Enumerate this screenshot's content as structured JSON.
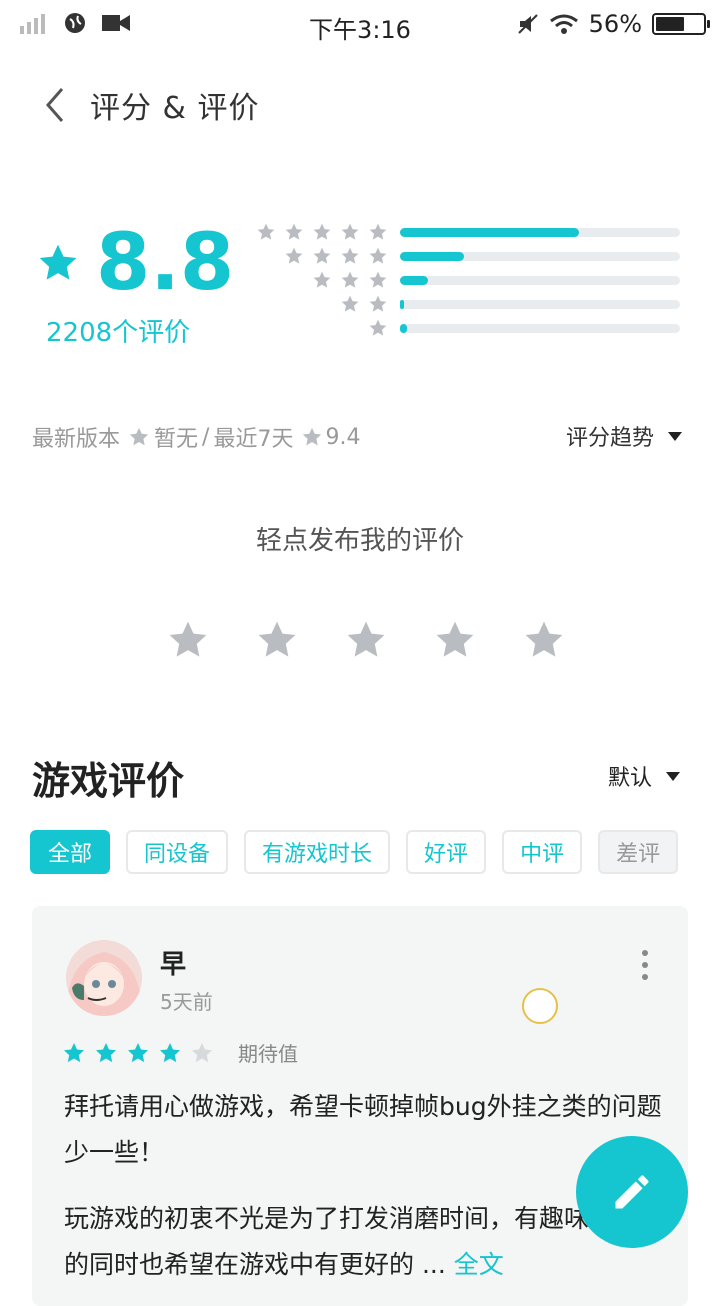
{
  "status_bar": {
    "time": "下午3:16",
    "battery_text": "56%"
  },
  "header": {
    "title": "评分 & 评价"
  },
  "summary": {
    "score": "8.8",
    "rating_count": "2208个评价",
    "distribution": [
      {
        "stars": 5,
        "fraction": 0.64
      },
      {
        "stars": 4,
        "fraction": 0.23
      },
      {
        "stars": 3,
        "fraction": 0.1
      },
      {
        "stars": 2,
        "fraction": 0.015
      },
      {
        "stars": 1,
        "fraction": 0.025
      }
    ]
  },
  "version": {
    "label": "最新版本",
    "current": "暂无",
    "separator": "/",
    "recent_label": "最近7天",
    "recent_score": "9.4",
    "trend_label": "评分趋势"
  },
  "rate": {
    "prompt": "轻点发布我的评价"
  },
  "reviews": {
    "section_title": "游戏评价",
    "sort_label": "默认",
    "filters": [
      "全部",
      "同设备",
      "有游戏时长",
      "好评",
      "中评",
      "差评"
    ],
    "items": [
      {
        "user": "早",
        "time": "5天前",
        "stars": 4,
        "tag": "期待值",
        "paragraph1": "拜托请用心做游戏，希望卡顿掉帧bug外挂之类的问题少一些！",
        "paragraph2": "玩游戏的初衷不光是为了打发消磨时间，有趣味性的同时也希望在游戏中有更好的 ...",
        "full_text": "全文"
      }
    ]
  },
  "colors": {
    "accent": "#15c5cf",
    "star_gray": "#b9bdc2",
    "muted_text": "#999999"
  }
}
